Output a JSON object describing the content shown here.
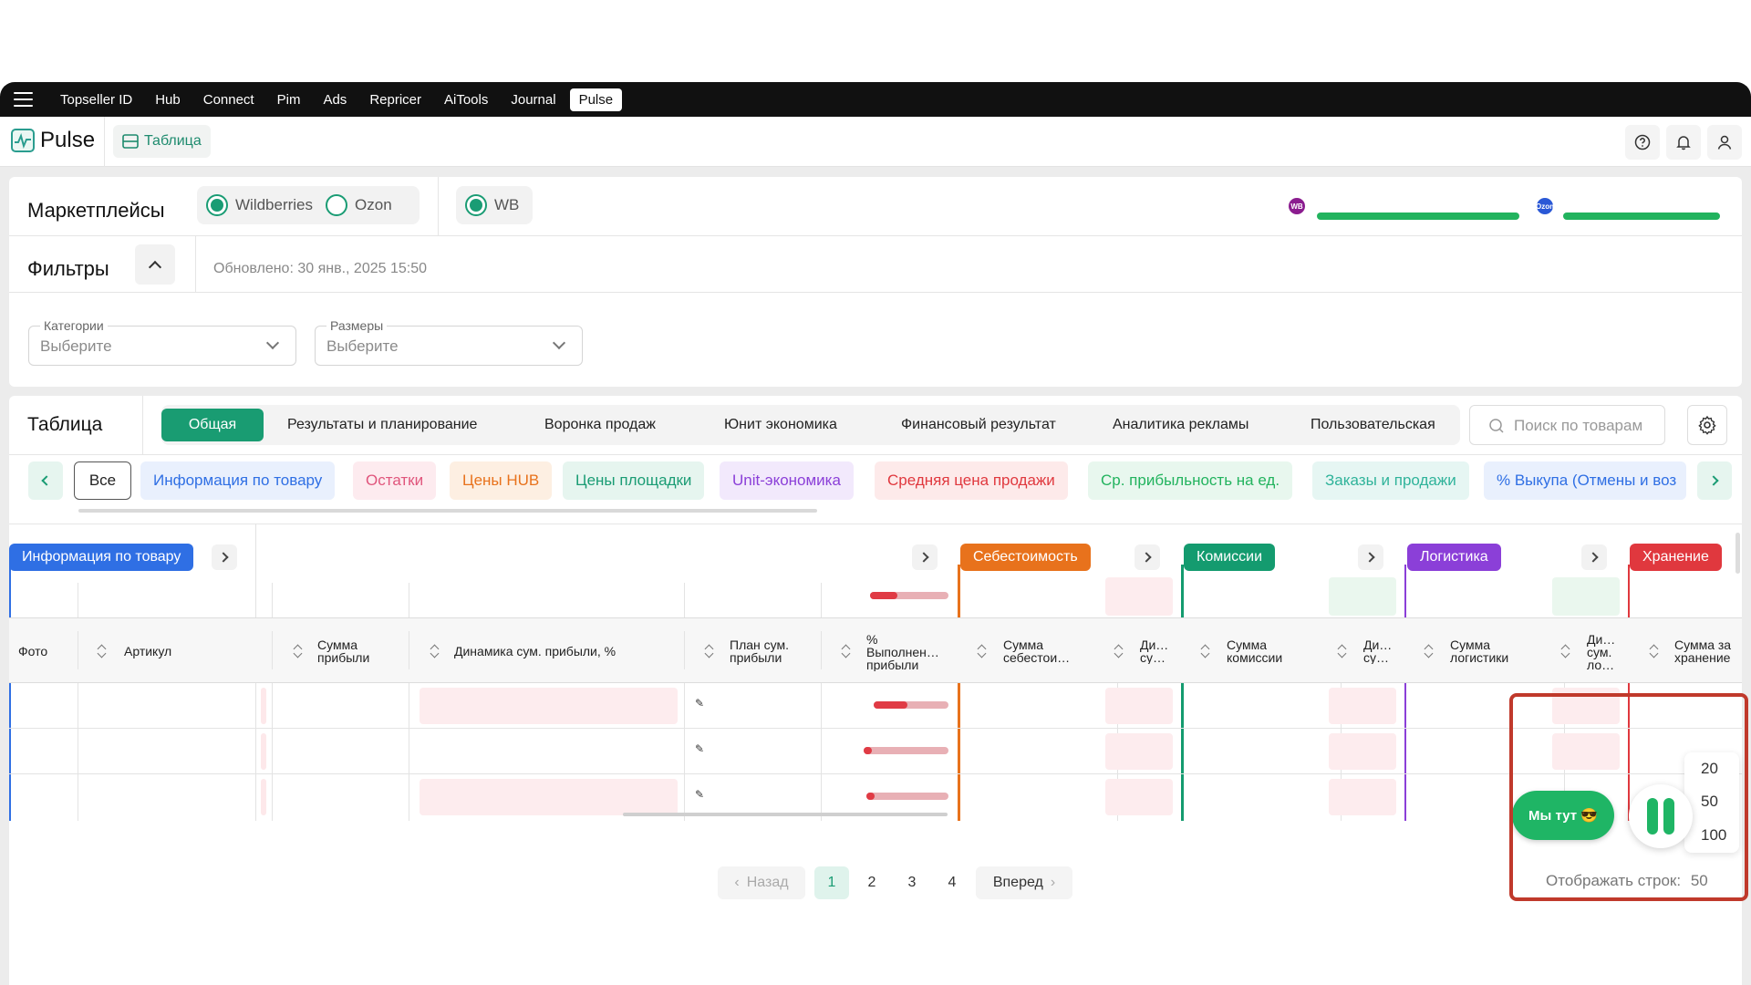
{
  "topnav": {
    "items": [
      "Topseller ID",
      "Hub",
      "Connect",
      "Pim",
      "Ads",
      "Repricer",
      "AiTools",
      "Journal",
      "Pulse"
    ],
    "active": "Pulse"
  },
  "header": {
    "app_name": "Pulse",
    "table_button": "Таблица",
    "icons": [
      "help-icon",
      "bell-icon",
      "user-icon"
    ]
  },
  "marketplaces": {
    "title": "Маркетплейсы",
    "options": [
      {
        "label": "Wildberries",
        "checked": true
      },
      {
        "label": "Ozon",
        "checked": false
      }
    ],
    "account": {
      "label": "WB",
      "checked": true
    },
    "status_icons": [
      "WB",
      "Ozon"
    ],
    "progress": [
      1.0,
      1.0
    ]
  },
  "filters": {
    "title": "Фильтры",
    "updated": "Обновлено: 30 янв., 2025 15:50",
    "categories": {
      "label": "Категории",
      "placeholder": "Выберите"
    },
    "sizes": {
      "label": "Размеры",
      "placeholder": "Выберите"
    }
  },
  "table": {
    "title": "Таблица",
    "tabs": [
      "Общая",
      "Результаты и планирование",
      "Воронка продаж",
      "Юнит экономика",
      "Финансовый результат",
      "Аналитика рекламы",
      "Пользовательская"
    ],
    "active_tab": "Общая",
    "search_placeholder": "Поиск по товарам",
    "chips": [
      {
        "label": "Все"
      },
      {
        "label": "Информация по товару",
        "color": "#2f6fe4",
        "bg": "#e9f0fd"
      },
      {
        "label": "Остатки",
        "color": "#e0557c",
        "bg": "#fdebef"
      },
      {
        "label": "Цены HUB",
        "color": "#e8721c",
        "bg": "#fdefe2"
      },
      {
        "label": "Цены площадки",
        "color": "#1a9c74",
        "bg": "#e6f5ef"
      },
      {
        "label": "Unit-экономика",
        "color": "#8b3fd8",
        "bg": "#f2e9fc"
      },
      {
        "label": "Средняя цена продажи",
        "color": "#e0383e",
        "bg": "#fdeaea"
      },
      {
        "label": "Ср. прибыльность на ед.",
        "color": "#22b35e",
        "bg": "#e8f7ee"
      },
      {
        "label": "Заказы и продажи",
        "color": "#2fb39a",
        "bg": "#e6f6f3"
      },
      {
        "label": "% Выкупа (Отмены и воз",
        "color": "#2f6fe4",
        "bg": "#e9f0fd"
      }
    ],
    "groups": [
      {
        "label": "Информация по товару",
        "color": "#2f6fe4"
      },
      {
        "label": "Себестоимость",
        "color": "#e8721c"
      },
      {
        "label": "Комиссии",
        "color": "#149b6f"
      },
      {
        "label": "Логистика",
        "color": "#8b3fd8"
      },
      {
        "label": "Хранение",
        "color": "#e0383e"
      }
    ],
    "columns": [
      "Фото",
      "Артикул",
      "Сумма прибыли",
      "Динамика сум. прибыли, %",
      "План сум. прибыли",
      "% Выполнен… прибыли",
      "Сумма себестои…",
      "Ди… су…",
      "Сумма комиссии",
      "Ди… су…",
      "Сумма логистики",
      "Ди… сум. ло…",
      "Сумма за хранение"
    ],
    "plan_completion": [
      0.35,
      0.45,
      0.0,
      0.1
    ]
  },
  "chat_button": "Мы тут 😎",
  "rows_per_page": {
    "options": [
      "20",
      "50",
      "100"
    ],
    "label": "Отображать строк:",
    "value": "50"
  },
  "pagination": {
    "prev": "Назад",
    "next": "Вперед",
    "pages": [
      "1",
      "2",
      "3",
      "4"
    ],
    "current": "1"
  }
}
